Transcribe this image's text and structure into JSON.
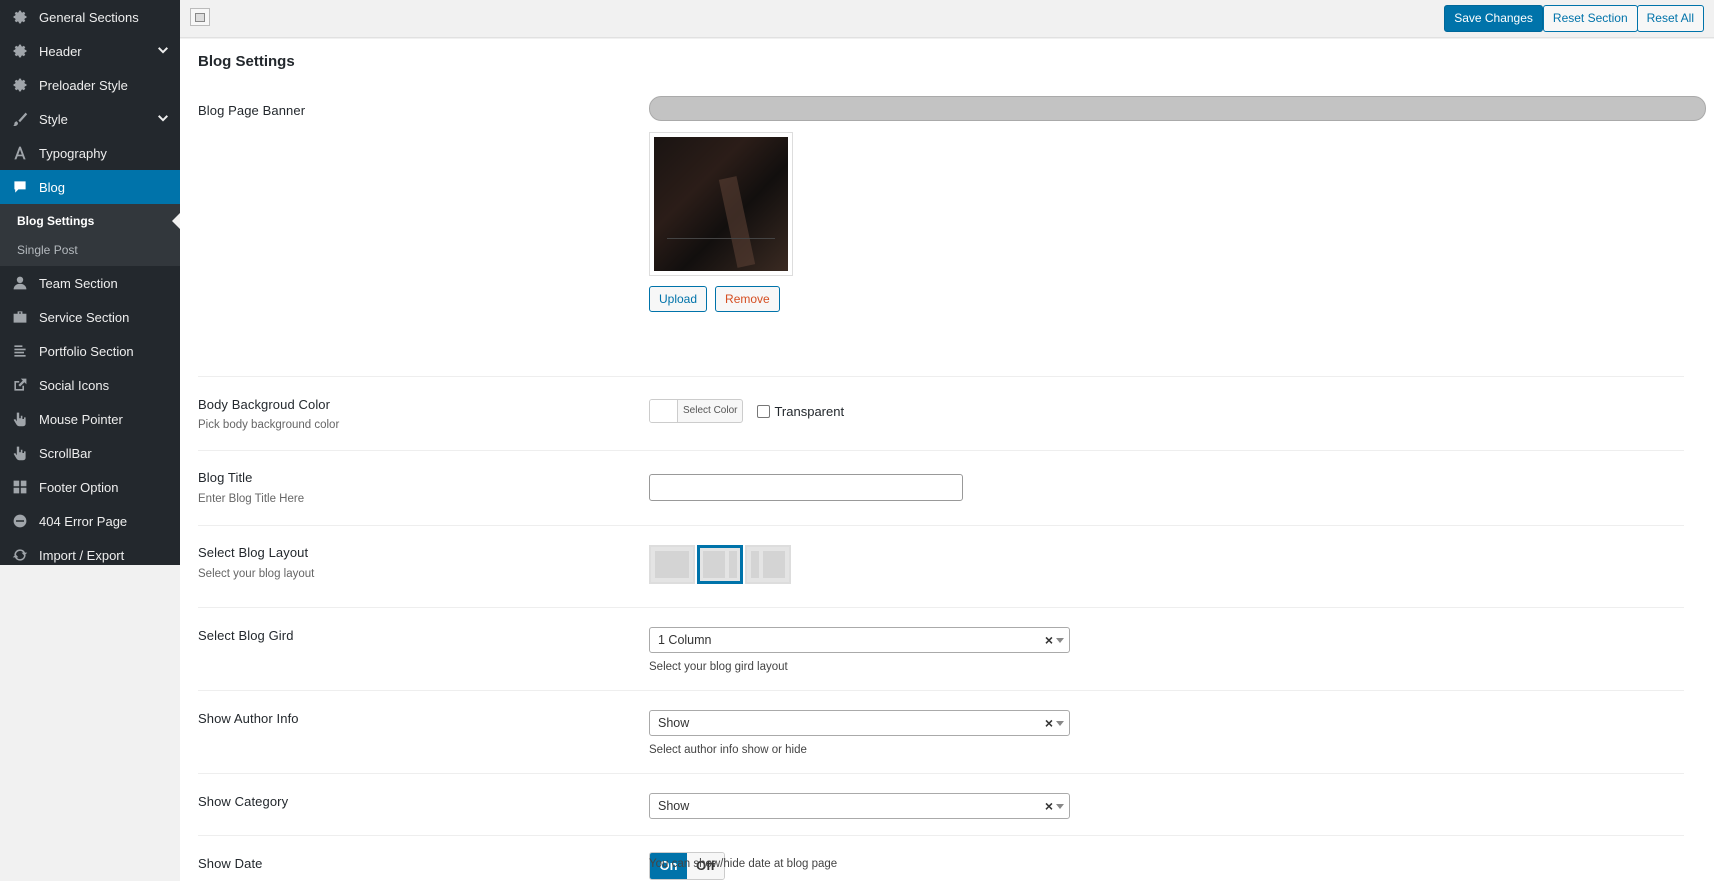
{
  "sidebar": {
    "items": [
      {
        "label": "General Sections",
        "icon": "gear-icon"
      },
      {
        "label": "Header",
        "icon": "gear-icon"
      },
      {
        "label": "Preloader Style",
        "icon": "gear-icon"
      },
      {
        "label": "Style",
        "icon": "brush-icon"
      },
      {
        "label": "Typography",
        "icon": "typography-icon"
      },
      {
        "label": "Blog",
        "icon": "comment-icon"
      },
      {
        "label": "Team Section",
        "icon": "person-icon"
      },
      {
        "label": "Service Section",
        "icon": "briefcase-icon"
      },
      {
        "label": "Portfolio Section",
        "icon": "list-icon"
      },
      {
        "label": "Social Icons",
        "icon": "share-icon"
      },
      {
        "label": "Mouse Pointer",
        "icon": "pointer-icon"
      },
      {
        "label": "ScrollBar",
        "icon": "scroll-icon"
      },
      {
        "label": "Footer Option",
        "icon": "grid-icon"
      },
      {
        "label": "404 Error Page",
        "icon": "minus-circle-icon"
      },
      {
        "label": "Import / Export",
        "icon": "refresh-icon"
      }
    ],
    "sub_items": [
      "Blog Settings",
      "Single Post"
    ]
  },
  "toolbar": {
    "save_label": "Save Changes",
    "reset_section_label": "Reset Section",
    "reset_all_label": "Reset All"
  },
  "main": {
    "title": "Blog Settings",
    "banner": {
      "label": "Blog Page Banner",
      "upload_label": "Upload",
      "remove_label": "Remove"
    },
    "body_bg": {
      "label": "Body Backgroud Color",
      "desc": "Pick body background color",
      "select_color_label": "Select Color",
      "transparent_label": "Transparent"
    },
    "blog_title": {
      "label": "Blog Title",
      "desc": "Enter Blog Title Here",
      "value": ""
    },
    "blog_layout": {
      "label": "Select Blog Layout",
      "desc": "Select your blog layout"
    },
    "blog_grid": {
      "label": "Select Blog Gird",
      "value": "1 Column",
      "desc": "Select your blog gird layout"
    },
    "author_info": {
      "label": "Show Author Info",
      "value": "Show",
      "desc": "Select author info show or hide"
    },
    "category": {
      "label": "Show Category",
      "value": "Show"
    },
    "date": {
      "label": "Show Date",
      "on_label": "On",
      "off_label": "Off",
      "desc": "You can show/hide date at blog page"
    }
  },
  "colors": {
    "accent": "#0073aa",
    "sidebar_bg": "#23282d",
    "remove": "#d54e21"
  }
}
